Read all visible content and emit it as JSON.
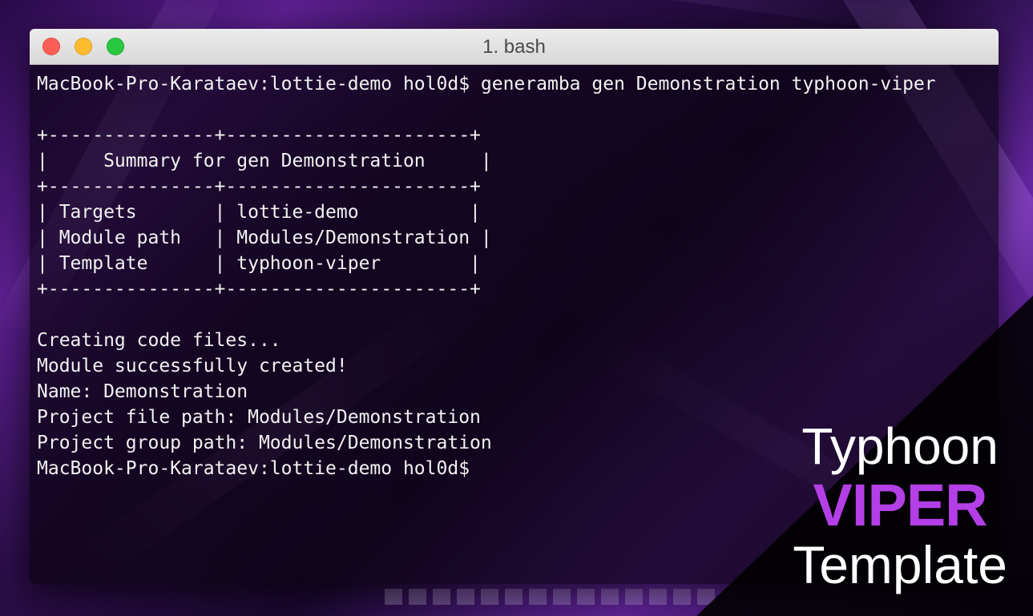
{
  "window": {
    "title": "1. bash"
  },
  "terminal": {
    "lines": [
      "MacBook-Pro-Karataev:lottie-demo hol0d$ generamba gen Demonstration typhoon-viper",
      "",
      "+---------------+----------------------+",
      "|     Summary for gen Demonstration     |",
      "+---------------+----------------------+",
      "| Targets       | lottie-demo          |",
      "| Module path   | Modules/Demonstration |",
      "| Template      | typhoon-viper        |",
      "+---------------+----------------------+",
      "",
      "Creating code files...",
      "Module successfully created!",
      "Name: Demonstration",
      "Project file path: Modules/Demonstration",
      "Project group path: Modules/Demonstration",
      "MacBook-Pro-Karataev:lottie-demo hol0d$"
    ]
  },
  "brand": {
    "line1": "Typhoon",
    "line2": "VIPER",
    "line3": "Template"
  },
  "colors": {
    "accent": "#b43fe6",
    "terminal_text": "#f2f2f2",
    "close": "#fc5f57",
    "minimize": "#fdbc2e",
    "zoom": "#28c840"
  }
}
